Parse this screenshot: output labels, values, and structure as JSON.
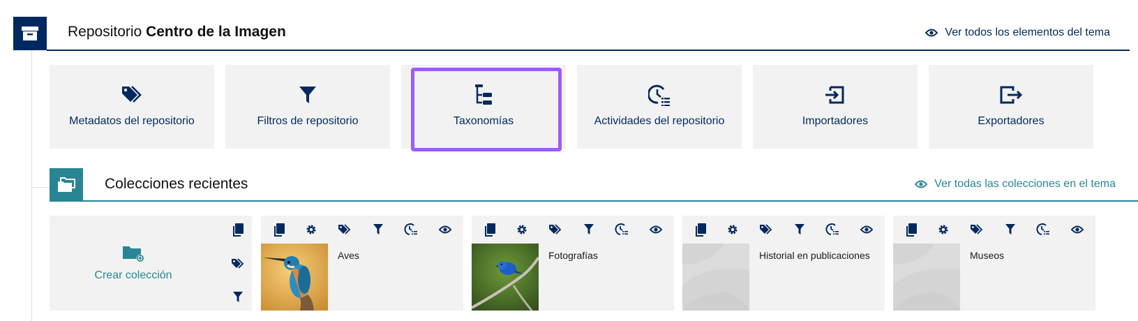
{
  "repository": {
    "title_prefix": "Repositorio",
    "title_name": "Centro de la Imagen",
    "view_all_link": "Ver todos los elementos del tema"
  },
  "tools": [
    {
      "label": "Metadatos del repositorio",
      "icon": "tags-icon"
    },
    {
      "label": "Filtros de repositorio",
      "icon": "filter-icon"
    },
    {
      "label": "Taxonomías",
      "icon": "taxonomy-icon",
      "highlighted": true
    },
    {
      "label": "Actividades del repositorio",
      "icon": "activities-icon"
    },
    {
      "label": "Importadores",
      "icon": "importer-icon"
    },
    {
      "label": "Exportadores",
      "icon": "exporter-icon"
    }
  ],
  "collections": {
    "section_title": "Colecciones recientes",
    "view_all_link": "Ver todas las colecciones en el tema",
    "create_label": "Crear colección",
    "items": [
      {
        "name": "Aves",
        "thumbnail": "kingfisher-photo"
      },
      {
        "name": "Fotografías",
        "thumbnail": "blue-bird-photo"
      },
      {
        "name": "Historial en publicaciones",
        "thumbnail": "placeholder"
      },
      {
        "name": "Museos",
        "thumbnail": "placeholder"
      }
    ]
  },
  "colors": {
    "navy": "#01295f",
    "teal": "#298596",
    "card_bg": "#f2f2f2",
    "highlight": "#9c5cf5"
  }
}
